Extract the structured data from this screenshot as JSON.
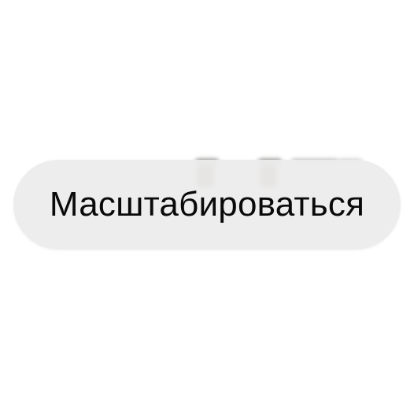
{
  "context_menu": {
    "action_label": "Масштабироваться"
  },
  "colors": {
    "pill_background": "#ececec",
    "label_text": "#0a0a0a",
    "page_background": "#ffffff"
  }
}
